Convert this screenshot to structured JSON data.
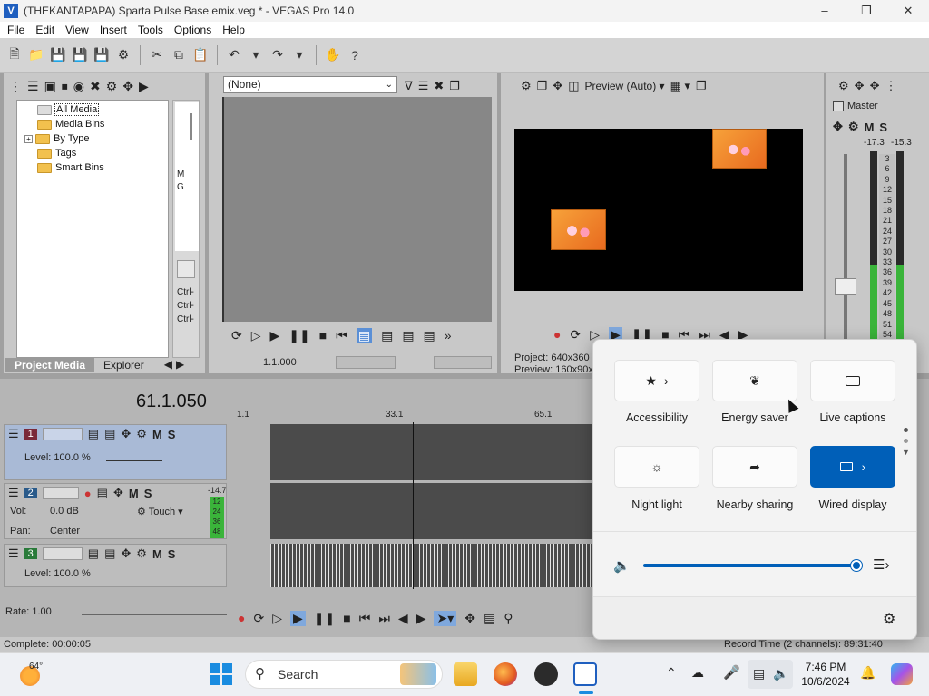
{
  "window": {
    "title": "(THEKANTAPAPA) Sparta Pulse Base emix.veg * - VEGAS Pro 14.0",
    "app_icon": "V"
  },
  "menu": [
    "File",
    "Edit",
    "View",
    "Insert",
    "Tools",
    "Options",
    "Help"
  ],
  "project_media": {
    "tree": [
      {
        "label": "All Media",
        "selected": true
      },
      {
        "label": "Media Bins"
      },
      {
        "label": "By Type",
        "expandable": true
      },
      {
        "label": "Tags"
      },
      {
        "label": "Smart Bins"
      }
    ],
    "side_text": [
      "M",
      "G"
    ],
    "ctrl_lines": [
      "Ctrl-",
      "Ctrl-",
      "Ctrl-"
    ],
    "tabs": [
      "Project Media",
      "Explorer"
    ]
  },
  "trimmer": {
    "selector_value": "(None)",
    "time": "1.1.000"
  },
  "preview": {
    "mode": "Preview (Auto)",
    "project_label": "Project:",
    "project_value": "640x360",
    "preview_label": "Preview:",
    "preview_value": "160x90x"
  },
  "master": {
    "label": "Master",
    "left_peak": "-17.3",
    "right_peak": "-15.3",
    "scale": [
      "3",
      "6",
      "9",
      "12",
      "15",
      "18",
      "21",
      "24",
      "27",
      "30",
      "33",
      "36",
      "39",
      "42",
      "45",
      "48",
      "51",
      "54"
    ],
    "buttons": [
      "M",
      "S"
    ]
  },
  "timeline": {
    "timecode": "61.1.050",
    "ruler": [
      "1.1",
      "33.1",
      "65.1"
    ],
    "tracks": [
      {
        "number": "1",
        "level_label": "Level: 100.0 %",
        "m": "M",
        "s": "S"
      },
      {
        "number": "2",
        "vol_label": "Vol:",
        "vol_value": "0.0 dB",
        "pan_label": "Pan:",
        "pan_value": "Center",
        "mode": "Touch",
        "meter_top": "-14.7",
        "meter_scale": [
          "12",
          "24",
          "36",
          "48"
        ],
        "m": "M",
        "s": "S"
      },
      {
        "number": "3",
        "level_label": "Level: 100.0 %",
        "m": "M",
        "s": "S"
      }
    ],
    "rate": "Rate: 1.00"
  },
  "status": {
    "left": "Complete: 00:00:05",
    "right": "Record Time (2 channels): 89:31:40"
  },
  "quick_settings": {
    "tiles": [
      {
        "label": "Accessibility",
        "icon": "accessibility-icon",
        "has_chevron": true
      },
      {
        "label": "Energy saver",
        "icon": "leaf-icon"
      },
      {
        "label": "Live captions",
        "icon": "captions-icon"
      },
      {
        "label": "Night light",
        "icon": "sun-icon"
      },
      {
        "label": "Nearby sharing",
        "icon": "share-icon"
      },
      {
        "label": "Wired display",
        "icon": "cast-icon",
        "active": true,
        "has_chevron": true
      }
    ],
    "volume_percent": 100
  },
  "taskbar": {
    "weather": "64°",
    "search_placeholder": "Search",
    "time": "7:46 PM",
    "date": "10/6/2024"
  },
  "colors": {
    "accent": "#005fb8",
    "meter_green": "#3ab43a",
    "folder": "#f2c14e"
  }
}
